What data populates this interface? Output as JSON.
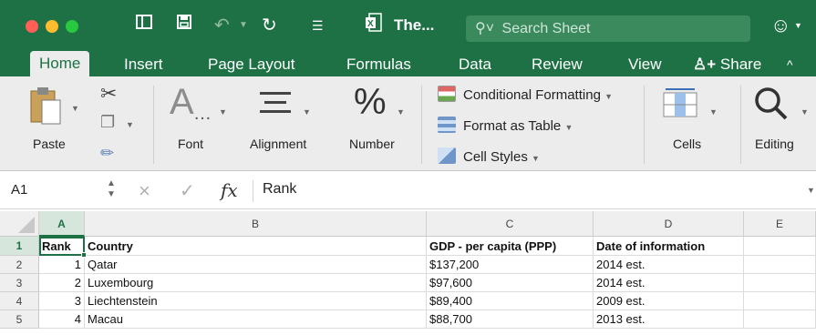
{
  "window": {
    "title": "The...",
    "search_placeholder": "Search Sheet",
    "colors": {
      "brand": "#1e7145",
      "close": "#ff5f57",
      "minimize": "#febc2e",
      "zoom": "#28c840"
    }
  },
  "tabs": [
    {
      "label": "Home",
      "active": true
    },
    {
      "label": "Insert"
    },
    {
      "label": "Page Layout"
    },
    {
      "label": "Formulas"
    },
    {
      "label": "Data"
    },
    {
      "label": "Review"
    },
    {
      "label": "View"
    },
    {
      "label": "Share"
    }
  ],
  "ribbon": {
    "paste": "Paste",
    "font": "Font",
    "alignment": "Alignment",
    "number": "Number",
    "conditional_formatting": "Conditional Formatting",
    "format_as_table": "Format as Table",
    "cell_styles": "Cell Styles",
    "cells": "Cells",
    "editing": "Editing"
  },
  "formula_bar": {
    "name_box": "A1",
    "fx": "fx",
    "content": "Rank"
  },
  "sheet": {
    "columns": [
      "A",
      "B",
      "C",
      "D",
      "E"
    ],
    "selected_column": "A",
    "rows": [
      {
        "num": "1",
        "cells": [
          "Rank",
          "Country",
          "GDP - per capita (PPP)",
          "Date of information",
          ""
        ]
      },
      {
        "num": "2",
        "cells": [
          "1",
          "Qatar",
          "$137,200",
          "2014 est.",
          ""
        ]
      },
      {
        "num": "3",
        "cells": [
          "2",
          "Luxembourg",
          "$97,600",
          "2014 est.",
          ""
        ]
      },
      {
        "num": "4",
        "cells": [
          "3",
          "Liechtenstein",
          "$89,400",
          "2009 est.",
          ""
        ]
      },
      {
        "num": "5",
        "cells": [
          "4",
          "Macau",
          "$88,700",
          "2013 est.",
          ""
        ]
      }
    ]
  }
}
